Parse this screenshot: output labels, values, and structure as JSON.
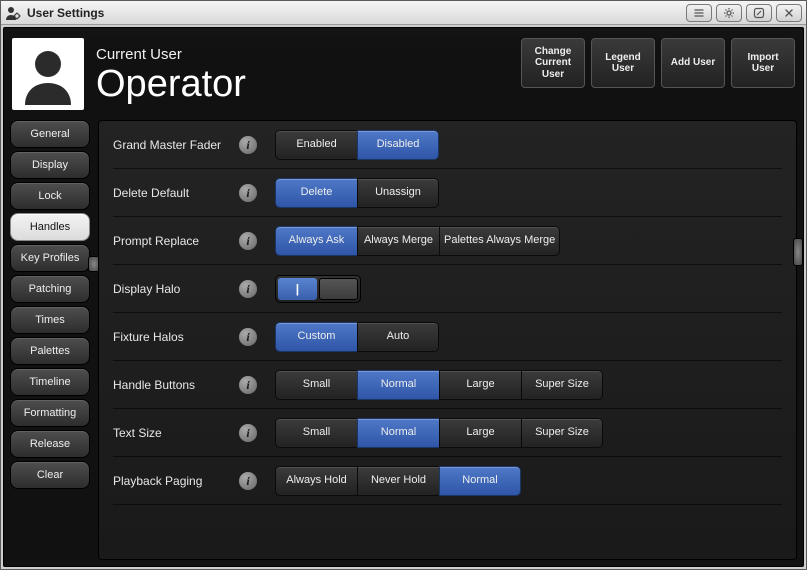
{
  "window": {
    "title": "User Settings"
  },
  "header": {
    "current_user_label": "Current User",
    "current_user_name": "Operator",
    "actions": {
      "change": "Change Current User",
      "legend": "Legend User",
      "add": "Add User",
      "import": "Import User"
    }
  },
  "sidebar": {
    "tabs": [
      {
        "id": "general",
        "label": "General",
        "selected": false
      },
      {
        "id": "display",
        "label": "Display",
        "selected": false
      },
      {
        "id": "lock",
        "label": "Lock",
        "selected": false
      },
      {
        "id": "handles",
        "label": "Handles",
        "selected": true
      },
      {
        "id": "keyprofiles",
        "label": "Key Profiles",
        "selected": false
      },
      {
        "id": "patching",
        "label": "Patching",
        "selected": false
      },
      {
        "id": "times",
        "label": "Times",
        "selected": false
      },
      {
        "id": "palettes",
        "label": "Palettes",
        "selected": false
      },
      {
        "id": "timeline",
        "label": "Timeline",
        "selected": false
      },
      {
        "id": "formatting",
        "label": "Formatting",
        "selected": false
      },
      {
        "id": "release",
        "label": "Release",
        "selected": false
      },
      {
        "id": "clear",
        "label": "Clear",
        "selected": false
      }
    ]
  },
  "settings": {
    "grand_master_fader": {
      "label": "Grand Master Fader",
      "options": [
        "Enabled",
        "Disabled"
      ],
      "selected": "Disabled"
    },
    "delete_default": {
      "label": "Delete Default",
      "options": [
        "Delete",
        "Unassign"
      ],
      "selected": "Delete"
    },
    "prompt_replace": {
      "label": "Prompt Replace",
      "options": [
        "Always Ask",
        "Always Merge",
        "Palettes Always Merge"
      ],
      "selected": "Always Ask"
    },
    "display_halo": {
      "label": "Display Halo",
      "type": "toggle",
      "value": true,
      "on_glyph": "|"
    },
    "fixture_halos": {
      "label": "Fixture Halos",
      "options": [
        "Custom",
        "Auto"
      ],
      "selected": "Custom"
    },
    "handle_buttons": {
      "label": "Handle Buttons",
      "options": [
        "Small",
        "Normal",
        "Large",
        "Super Size"
      ],
      "selected": "Normal"
    },
    "text_size": {
      "label": "Text Size",
      "options": [
        "Small",
        "Normal",
        "Large",
        "Super Size"
      ],
      "selected": "Normal"
    },
    "playback_paging": {
      "label": "Playback Paging",
      "options": [
        "Always Hold",
        "Never Hold",
        "Normal"
      ],
      "selected": "Normal"
    }
  },
  "colors": {
    "accent": "#3f66b8",
    "dark_bg": "#1a1a1a",
    "button_bg": "#303030"
  }
}
